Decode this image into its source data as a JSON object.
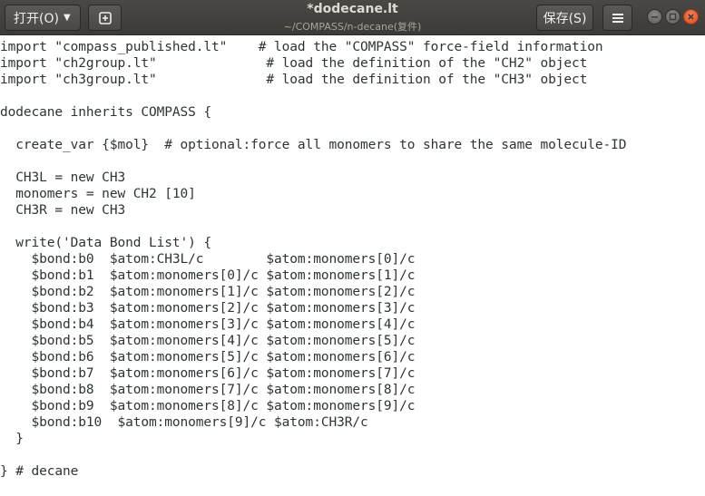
{
  "titlebar": {
    "open_label": "打开(O)",
    "title": "*dodecane.lt",
    "subtitle": "~/COMPASS/n-decane(复件)",
    "save_label": "保存(S)"
  },
  "editor": {
    "lines": [
      "import \"compass_published.lt\"    # load the \"COMPASS\" force-field information",
      "import \"ch2group.lt\"              # load the definition of the \"CH2\" object",
      "import \"ch3group.lt\"              # load the definition of the \"CH3\" object",
      "",
      "dodecane inherits COMPASS {",
      "",
      "  create_var {$mol}  # optional:force all monomers to share the same molecule-ID",
      "",
      "  CH3L = new CH3",
      "  monomers = new CH2 [10]",
      "  CH3R = new CH3",
      "",
      "  write('Data Bond List') {",
      "    $bond:b0  $atom:CH3L/c        $atom:monomers[0]/c",
      "    $bond:b1  $atom:monomers[0]/c $atom:monomers[1]/c",
      "    $bond:b2  $atom:monomers[1]/c $atom:monomers[2]/c",
      "    $bond:b3  $atom:monomers[2]/c $atom:monomers[3]/c",
      "    $bond:b4  $atom:monomers[3]/c $atom:monomers[4]/c",
      "    $bond:b5  $atom:monomers[4]/c $atom:monomers[5]/c",
      "    $bond:b6  $atom:monomers[5]/c $atom:monomers[6]/c",
      "    $bond:b7  $atom:monomers[6]/c $atom:monomers[7]/c",
      "    $bond:b8  $atom:monomers[7]/c $atom:monomers[8]/c",
      "    $bond:b9  $atom:monomers[8]/c $atom:monomers[9]/c",
      "    $bond:b10  $atom:monomers[9]/c $atom:CH3R/c",
      "  }",
      "",
      "} # decane"
    ]
  }
}
